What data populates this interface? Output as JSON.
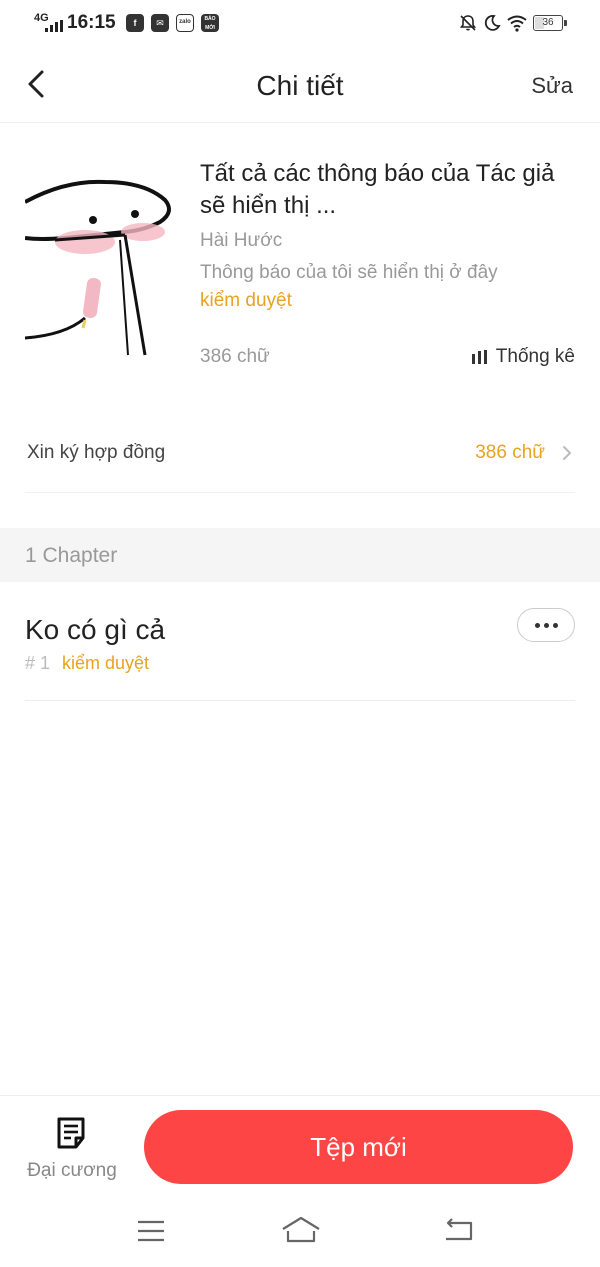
{
  "status_bar": {
    "network": "4G",
    "time": "16:15",
    "app_icons": [
      "facebook-icon",
      "mail-icon",
      "zalo-icon",
      "baomoi-icon"
    ],
    "zalo_label": "zalo",
    "baomoi_label": "BÁO MỚI",
    "right_icons": [
      "bell-off-icon",
      "moon-icon",
      "wifi-icon",
      "battery-icon"
    ],
    "battery": "36"
  },
  "header": {
    "title": "Chi tiết",
    "edit_label": "Sửa"
  },
  "book": {
    "title": "Tất cả các thông báo của Tác giả sẽ hiển thị ...",
    "genre": "Hài Hước",
    "description": "Thông báo của tôi sẽ hiển thị ở đây",
    "status": "kiểm duyệt",
    "word_count": "386 chữ",
    "stats_label": "Thống kê"
  },
  "contract": {
    "label": "Xin ký hợp đồng",
    "value": "386 chữ"
  },
  "chapters": {
    "count_label": "1 Chapter",
    "items": [
      {
        "title": "Ko có gì cả",
        "number": "# 1",
        "status": "kiểm duyệt"
      }
    ]
  },
  "bottom_bar": {
    "outline_label": "Đại cương",
    "new_file_label": "Tệp mới"
  },
  "colors": {
    "accent": "#fe4545",
    "status": "#e8a320",
    "muted": "#999999"
  }
}
